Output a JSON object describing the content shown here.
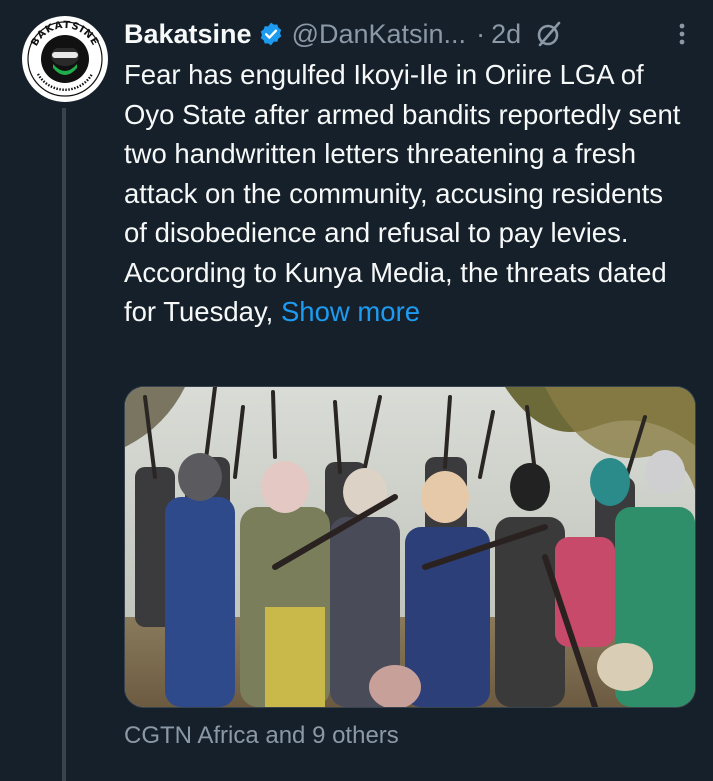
{
  "tweet": {
    "display_name": "Bakatsine",
    "handle": "@DanKatsin...",
    "separator": "·",
    "time": "2d",
    "body": "Fear has engulfed Ikoyi-Ile in Oriire LGA of Oyo State after armed bandits reportedly sent two handwritten letters threatening a fresh attack on the community, accusing residents of disobedience and refusal to pay levies. According to Kunya Media, the threats dated for Tuesday,",
    "show_more": "Show more",
    "tagged": "CGTN Africa and 9 others"
  },
  "avatar": {
    "logo_text": "BAKATSINE"
  },
  "colors": {
    "background": "#15202b",
    "accent": "#1d9bf0",
    "secondary_text": "#8b98a5",
    "thread_line": "#38444d"
  },
  "icons": {
    "verified": "verified-badge-icon",
    "grok": "grok-icon",
    "more": "more-vertical-icon"
  }
}
